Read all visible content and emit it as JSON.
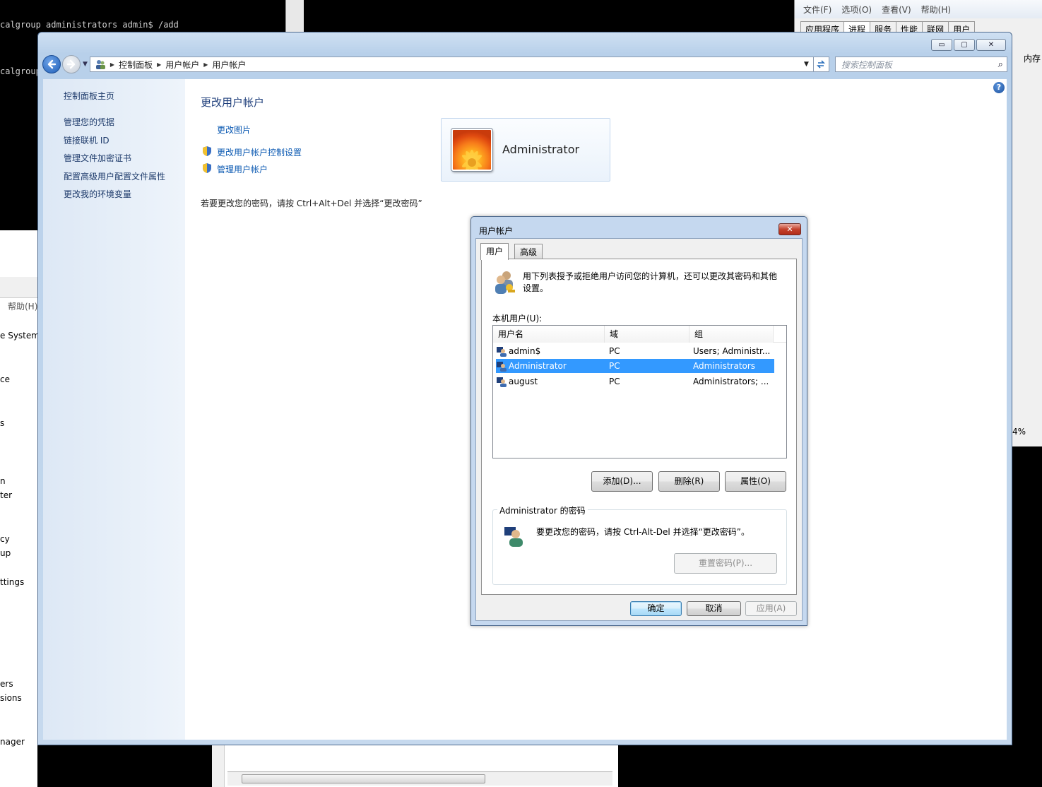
{
  "console": {
    "line1": "calgroup administrators admin$ /add",
    "line2": "calgroup"
  },
  "taskmgr": {
    "menu": [
      "文件(F)",
      "选项(O)",
      "查看(V)",
      "帮助(H)"
    ],
    "tabs": [
      "应用程序",
      "进程",
      "服务",
      "性能",
      "联网",
      "用户"
    ],
    "col_memory": "内存",
    "cpu_pct": "4%"
  },
  "bg_left": {
    "help_menu": "帮助(H)",
    "items": [
      "e System",
      "ce",
      "s",
      "n",
      "ter",
      "cy",
      "up",
      "ttings",
      "ers",
      "sions",
      "nager"
    ]
  },
  "window": {
    "caption_buttons": {
      "minimize": "▭",
      "maximize": "▢",
      "close": "✕"
    },
    "breadcrumb": [
      "控制面板",
      "用户帐户",
      "用户帐户"
    ],
    "search_placeholder": "搜索控制面板",
    "left_links": [
      "控制面板主页",
      "管理您的凭据",
      "链接联机 ID",
      "管理文件加密证书",
      "配置高级用户配置文件属性",
      "更改我的环境变量"
    ],
    "heading": "更改用户帐户",
    "links": [
      "更改图片",
      "更改用户帐户控制设置",
      "管理用户帐户"
    ],
    "account_name": "Administrator",
    "password_hint": "若要更改您的密码，请按 Ctrl+Alt+Del 并选择“更改密码”"
  },
  "dialog": {
    "title": "用户帐户",
    "tabs": [
      "用户",
      "高级"
    ],
    "intro": "用下列表授予或拒绝用户访问您的计算机，还可以更改其密码和其他设置。",
    "local_users_label": "本机用户(U):",
    "columns": [
      "用户名",
      "域",
      "组"
    ],
    "rows": [
      {
        "name": "admin$",
        "domain": "PC",
        "group": "Users; Administr..."
      },
      {
        "name": "Administrator",
        "domain": "PC",
        "group": "Administrators"
      },
      {
        "name": "august",
        "domain": "PC",
        "group": "Administrators; ..."
      }
    ],
    "selected_row": 1,
    "buttons": {
      "add": "添加(D)...",
      "remove": "删除(R)",
      "properties": "属性(O)"
    },
    "password_group_title": "Administrator 的密码",
    "password_text": "要更改您的密码，请按 Ctrl-Alt-Del 并选择“更改密码”。",
    "reset_password": "重置密码(P)...",
    "ok": "确定",
    "cancel": "取消",
    "apply": "应用(A)"
  },
  "colors": {
    "selection": "#3399ff",
    "link": "#0b59b2",
    "heading": "#1e3e7b"
  }
}
